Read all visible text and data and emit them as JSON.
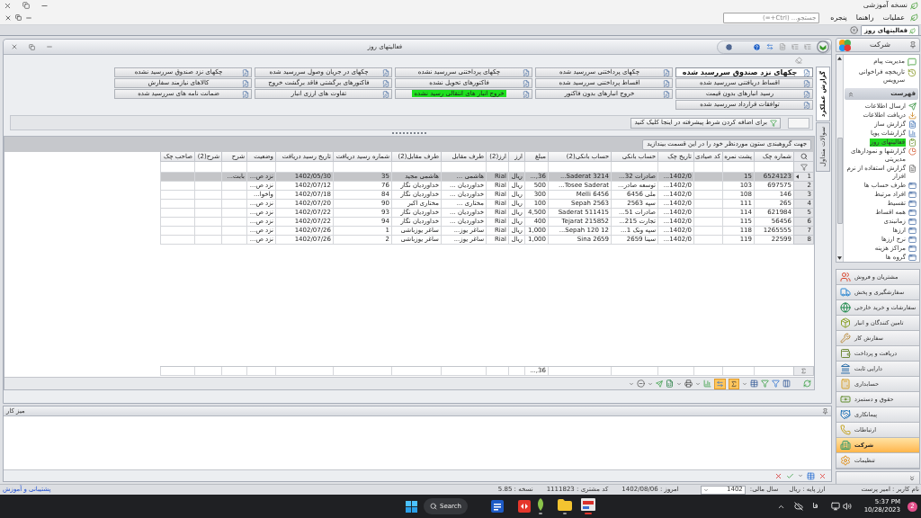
{
  "window": {
    "title": "نسخه آموزشی"
  },
  "menu": [
    "عملیات",
    "راهنما",
    "پنجره"
  ],
  "search": {
    "placeholder": "جستجو... (Ctrl+=)"
  },
  "document_tabs": [
    {
      "label": "فعالیتهای روز",
      "selected": true
    }
  ],
  "panel": {
    "title": "فعالیتهای روز"
  },
  "activity_buttons": [
    [
      {
        "label": "چکهای نزد صندوق سررسید شده",
        "selected": true,
        "highlighted": false
      },
      {
        "label": "اقساط دریافتنی سررسید شده",
        "selected": false,
        "highlighted": false
      },
      {
        "label": "رسید انبارهای بدون قیمت",
        "selected": false,
        "highlighted": false
      },
      {
        "label": "توافقات قرارداد سررسید شده",
        "selected": false,
        "highlighted": false
      }
    ],
    [
      {
        "label": "چکهای پرداختنی سررسید شده",
        "selected": false,
        "highlighted": false
      },
      {
        "label": "اقساط پرداختنی سررسید شده",
        "selected": false,
        "highlighted": false
      },
      {
        "label": "خروج انبارهای بدون فاکتور",
        "selected": false,
        "highlighted": false
      }
    ],
    [
      {
        "label": "چکهای پرداختنی سررسید نشده",
        "selected": false,
        "highlighted": false
      },
      {
        "label": "فاکتورهای تحویل نشده",
        "selected": false,
        "highlighted": false
      },
      {
        "label": "خروج انبار های انتقالی رسید نشده",
        "selected": false,
        "highlighted": true
      }
    ],
    [
      {
        "label": "چکهای در جریان وصول سررسید شده",
        "selected": false,
        "highlighted": false
      },
      {
        "label": "فاکتورهای برگشتی فاقد برگشت خروج",
        "selected": false,
        "highlighted": false
      },
      {
        "label": "تفاوت های ارزی انبار",
        "selected": false,
        "highlighted": false
      }
    ],
    [
      {
        "label": "چکهای نزد صندوق سررسید نشده",
        "selected": false,
        "highlighted": false
      },
      {
        "label": "کالاهای نیازمند سفارش",
        "selected": false,
        "highlighted": false
      },
      {
        "label": "ضمانت نامه های سررسید شده",
        "selected": false,
        "highlighted": false
      }
    ]
  ],
  "side_tabs": [
    {
      "label": "گزارش عملکرد",
      "selected": true
    },
    {
      "label": "سوالات متداول",
      "selected": false
    }
  ],
  "advanced_filter": {
    "label": "برای اضافه کردن شرط پیشرفته در اینجا کلیک کنید"
  },
  "group_panel": {
    "hint": "جهت گروهبندی ستون موردنظر خود را در این قسمت بیندازید"
  },
  "table": {
    "columns": [
      "شماره چک",
      "پشت نمره",
      "کد صیادی",
      "تاریخ چک",
      "حساب بانکی",
      "حساب بانکی(2)",
      "مبلغ",
      "ارز",
      "ارز(2)",
      "طرف مقابل",
      "طرف مقابل(2)",
      "شماره رسید دریافت",
      "تاریخ رسید دریافت",
      "وضعیت",
      "شرح",
      "شرح(2)",
      "صاحب چک"
    ],
    "rows": [
      {
        "number": "1",
        "selected": true,
        "cells": [
          "6524123",
          "15",
          null,
          "1402/0...",
          "صادرات 32...",
          "Saderat 3214...",
          "36,...",
          "ریال",
          "Rial",
          "هاشمی ...",
          "هاشمی مجید",
          "35",
          "1402/05/30",
          "نزد ص...",
          "بابت...",
          null,
          null
        ]
      },
      {
        "number": "2",
        "selected": false,
        "cells": [
          "697575",
          "103",
          null,
          "1402/0...",
          "توسعه صادر...",
          "Tosee Saderat...",
          "500",
          "ریال",
          "Rial",
          "خداوردیان ...",
          "خداوردیان نگار",
          "76",
          "1402/07/12",
          "نزد ص...",
          null,
          null,
          null
        ]
      },
      {
        "number": "3",
        "selected": false,
        "cells": [
          "146",
          "108",
          null,
          "1402/0...",
          "ملی 6456",
          "Melli 6456",
          "300",
          "ریال",
          "Rial",
          "خداوردیان ...",
          "خداوردیان نگار",
          "84",
          "1402/07/18",
          "واخوا...",
          null,
          null,
          null
        ]
      },
      {
        "number": "4",
        "selected": false,
        "cells": [
          "265",
          "111",
          null,
          "1402/0...",
          "سپه 2563",
          "Sepah 2563",
          "100",
          "ریال",
          "Rial",
          "مختاری ...",
          "مختاری اکبر",
          "90",
          "1402/07/20",
          "نزد ص...",
          null,
          null,
          null
        ]
      },
      {
        "number": "5",
        "selected": false,
        "cells": [
          "621984",
          "114",
          null,
          "1402/0...",
          "صادرات 51...",
          "Saderat 511415",
          "4,500",
          "ریال",
          "Rial",
          "خداوردیان ...",
          "خداوردیان نگار",
          "93",
          "1402/07/22",
          "نزد ص...",
          null,
          null,
          null
        ]
      },
      {
        "number": "6",
        "selected": false,
        "cells": [
          "56456",
          "115",
          null,
          "1402/0...",
          "تجارت 215...",
          "Tejarat 215852",
          "400",
          "ریال",
          "Rial",
          "خداوردیان ...",
          "خداوردیان نگار",
          "94",
          "1402/07/22",
          "نزد ص...",
          null,
          null,
          null
        ]
      },
      {
        "number": "7",
        "selected": false,
        "cells": [
          "1265555",
          "118",
          null,
          "1402/0...",
          "سپه ونک 1...",
          "Sepah 120 12...",
          "1,000",
          "ریال",
          "Rial",
          "ساغر یوز...",
          "ساغر یوزباشی",
          "1",
          "1402/07/26",
          "نزد ص...",
          null,
          null,
          null
        ]
      },
      {
        "number": "8",
        "selected": false,
        "cells": [
          "22599",
          "119",
          null,
          "1402/0...",
          "سینا 2659",
          "Sina 2659",
          "1,000",
          "ریال",
          "Rial",
          "ساغر یوز...",
          "ساغر یوزباشی",
          "2",
          "1402/07/26",
          "نزد ص...",
          null,
          null,
          null
        ]
      }
    ],
    "summary_amount": "36,..."
  },
  "grid_toolbar": {
    "sum_on": true,
    "fit_width_on": true
  },
  "workspace": {
    "title": "میز کار"
  },
  "sidebar": {
    "title": "شرکت",
    "shortcuts": [
      "مدیریت پیام",
      "تاریخچه فراخوانی سرویس"
    ],
    "list": {
      "title": "فهرست",
      "expanded": true,
      "items": [
        {
          "label": "ارسال اطلاعات",
          "selected": false
        },
        {
          "label": "دریافت اطلاعات",
          "selected": false
        },
        {
          "label": "گزارش ساز",
          "selected": false
        },
        {
          "label": "گزارشات پویا",
          "selected": false
        },
        {
          "label": "فعالیتهای روز",
          "selected": true
        },
        {
          "label": "گزارشها و نمودارهای مدیریتی",
          "selected": false
        },
        {
          "label": "گزارش استفاده از نرم افزار",
          "selected": false
        },
        {
          "label": "طرف حساب ها",
          "selected": false
        },
        {
          "label": "افراد مرتبط",
          "selected": false
        },
        {
          "label": "تقسیط",
          "selected": false
        },
        {
          "label": "همه اقساط",
          "selected": false
        },
        {
          "label": "زمانبندی",
          "selected": false
        },
        {
          "label": "ارزها",
          "selected": false
        },
        {
          "label": "نرخ ارزها",
          "selected": false
        },
        {
          "label": "مراکز هزینه",
          "selected": false
        },
        {
          "label": "گروه ها",
          "selected": false
        }
      ]
    },
    "modules": [
      {
        "label": "مشتریان و فروش",
        "selected": false
      },
      {
        "label": "سفارشگیری و پخش",
        "selected": false
      },
      {
        "label": "سفارشات و خرید خارجی",
        "selected": false
      },
      {
        "label": "تامین کنندگان و انبار",
        "selected": false
      },
      {
        "label": "سفارش کار",
        "selected": false
      },
      {
        "label": "دریافت و پرداخت",
        "selected": false
      },
      {
        "label": "دارایی ثابت",
        "selected": false
      },
      {
        "label": "حسابداری",
        "selected": false
      },
      {
        "label": "حقوق و دستمزد",
        "selected": false
      },
      {
        "label": "پیمانکاری",
        "selected": false
      },
      {
        "label": "ارتباطات",
        "selected": false
      },
      {
        "label": "شرکت",
        "selected": true
      },
      {
        "label": "تنظیمات",
        "selected": false
      }
    ]
  },
  "status_bar": {
    "user": "نام کاربر : امیر پرست",
    "base_currency": "ارز پایه : ریال",
    "fiscal_year_label": "سال مالی:",
    "fiscal_year": "1402",
    "today": "امروز : 1402/08/06",
    "customer_code": "کد مشتری : 1111823",
    "version": "نسخه : 5.85",
    "support_link": "پشتیبانی و آموزش"
  },
  "taskbar": {
    "search": "Search",
    "language": "فا",
    "time": "5:37 PM",
    "date": "10/28/2023",
    "notifications": "2"
  }
}
